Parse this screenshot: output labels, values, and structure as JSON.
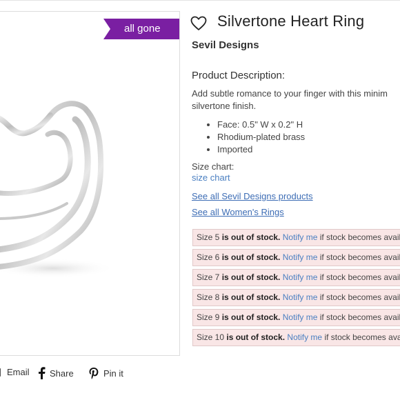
{
  "product": {
    "badge": "all gone",
    "title": "Silvertone Heart Ring",
    "brand": "Sevil Designs",
    "description_heading": "Product Description:",
    "description_line1": "Add subtle romance to your finger with this minim",
    "description_line2": "silvertone finish.",
    "features": [
      "Face: 0.5\" W x 0.2\" H",
      "Rhodium-plated brass",
      "Imported"
    ],
    "size_chart_label": "Size chart:",
    "size_chart_link": "size chart",
    "see_all_brand": "See all Sevil Designs products",
    "see_all_category": "See all Women's Rings"
  },
  "stock": {
    "status_text": "is out of stock.",
    "notify_text": "Notify me",
    "suffix": "if stock becomes avail",
    "sizes": [
      {
        "label": "Size 5"
      },
      {
        "label": "Size 6"
      },
      {
        "label": "Size 7"
      },
      {
        "label": "Size 8"
      },
      {
        "label": "Size 9"
      },
      {
        "label": "Size 10"
      }
    ]
  },
  "share": {
    "email": "Email",
    "share": "Share",
    "pin": "Pin it"
  },
  "colors": {
    "badge": "#7a1fa2",
    "link": "#3d6db5",
    "stock_bg": "#f9e6e6"
  },
  "icons": [
    "heart-outline-icon",
    "email-icon",
    "facebook-icon",
    "pinterest-icon"
  ]
}
